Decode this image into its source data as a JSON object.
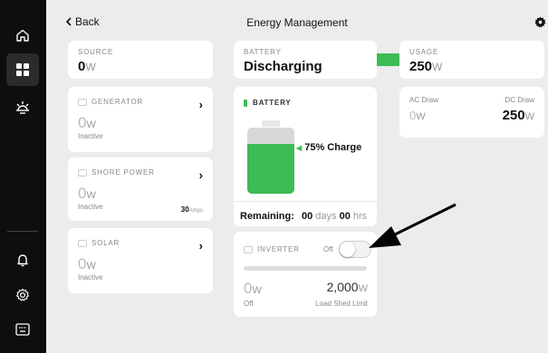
{
  "header": {
    "back_label": "Back",
    "title": "Energy Management"
  },
  "nav": {
    "items": [
      {
        "name": "home",
        "icon": "home-icon"
      },
      {
        "name": "dashboard",
        "icon": "grid-icon",
        "active": true
      },
      {
        "name": "lighting",
        "icon": "sun-icon"
      },
      {
        "name": "alerts",
        "icon": "bell-icon"
      },
      {
        "name": "settings",
        "icon": "gear-icon"
      },
      {
        "name": "keyboard",
        "icon": "keyboard-icon"
      }
    ]
  },
  "source": {
    "label": "SOURCE",
    "value": "0",
    "unit": "W"
  },
  "generator": {
    "label": "GENERATOR",
    "value": "0",
    "unit": "W",
    "status": "Inactive"
  },
  "shore_power": {
    "label": "SHORE POWER",
    "value": "0",
    "unit": "W",
    "status": "Inactive",
    "amps_value": "30",
    "amps_unit": "Amps"
  },
  "solar": {
    "label": "SOLAR",
    "value": "0",
    "unit": "W",
    "status": "Inactive"
  },
  "battery_summary": {
    "label": "BATTERY",
    "status": "Discharging"
  },
  "battery": {
    "label": "BATTERY",
    "charge_percent": 75,
    "charge_text": "75% Charge",
    "remaining_label": "Remaining:",
    "days_value": "00",
    "days_unit": "days",
    "hrs_value": "00",
    "hrs_unit": "hrs"
  },
  "usage": {
    "label": "USAGE",
    "value": "250",
    "unit": "W",
    "ac_label": "AC Draw",
    "ac_value": "0",
    "ac_unit": "W",
    "dc_label": "DC Draw",
    "dc_value": "250",
    "dc_unit": "W"
  },
  "inverter": {
    "label": "INVERTER",
    "toggle_label": "Off",
    "value": "0",
    "unit": "W",
    "status": "Off",
    "limit_value": "2,000",
    "limit_unit": "W",
    "limit_label": "Load Shed Limit"
  },
  "colors": {
    "accent_green": "#3dbb56",
    "nav_bg": "#0e0e0e",
    "page_bg": "#ececec"
  }
}
